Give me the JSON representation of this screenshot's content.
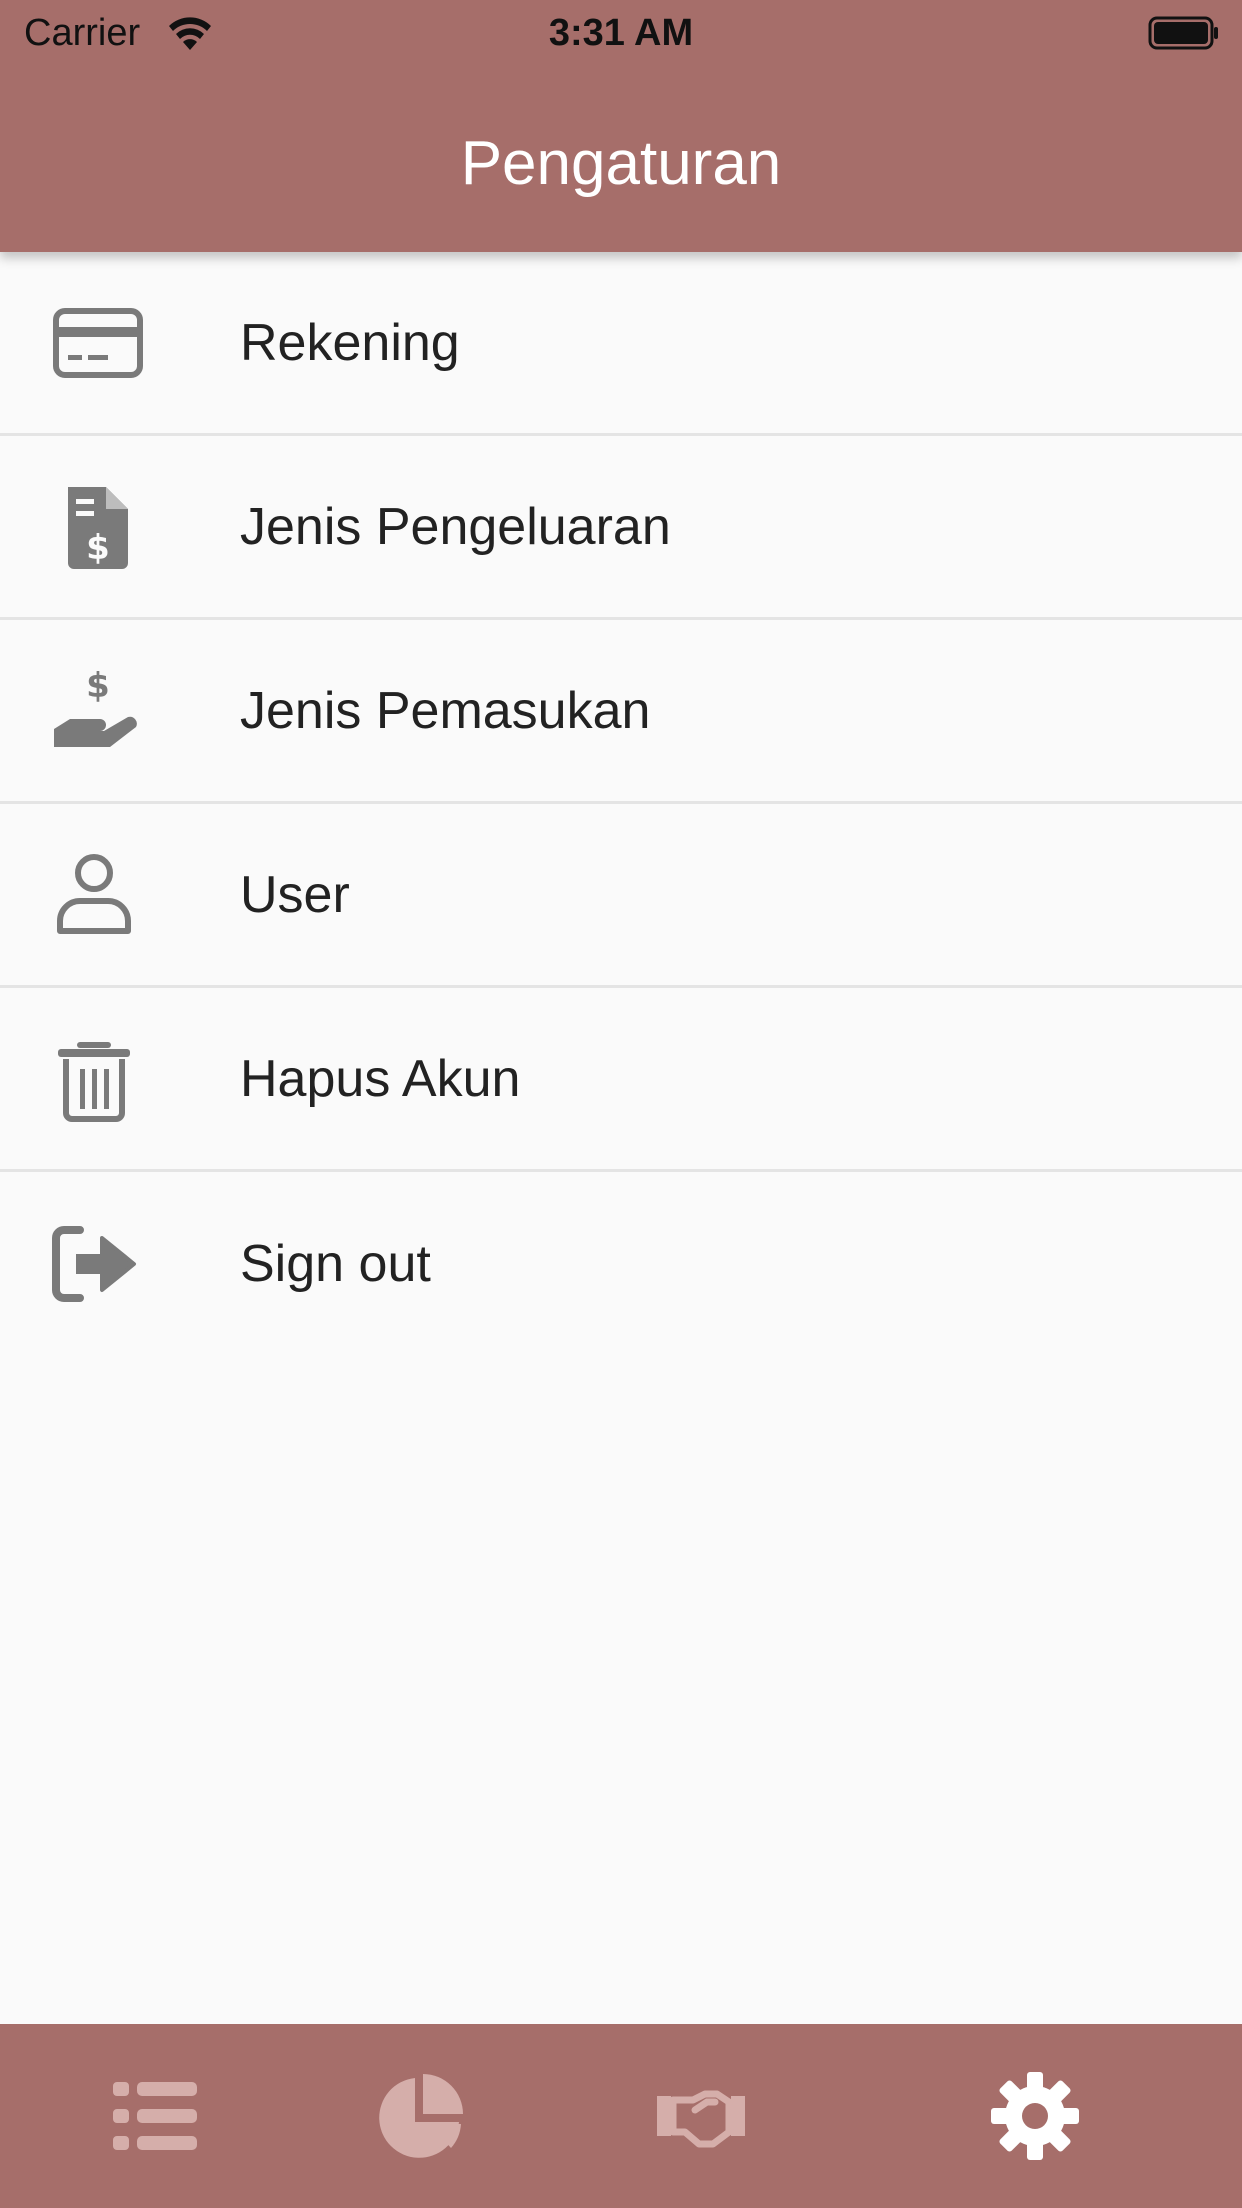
{
  "status_bar": {
    "carrier": "Carrier",
    "time": "3:31 AM"
  },
  "header": {
    "title": "Pengaturan"
  },
  "menu": {
    "items": [
      {
        "label": "Rekening",
        "icon": "credit-card-icon"
      },
      {
        "label": "Jenis Pengeluaran",
        "icon": "invoice-dollar-icon"
      },
      {
        "label": "Jenis Pemasukan",
        "icon": "hand-dollar-icon"
      },
      {
        "label": "User",
        "icon": "user-icon"
      },
      {
        "label": "Hapus Akun",
        "icon": "trash-icon"
      },
      {
        "label": "Sign out",
        "icon": "sign-out-icon"
      }
    ]
  },
  "tabbar": {
    "tabs": [
      {
        "icon": "list-icon",
        "active": false
      },
      {
        "icon": "pie-chart-icon",
        "active": false
      },
      {
        "icon": "handshake-icon",
        "active": false
      },
      {
        "icon": "gear-icon",
        "active": true
      }
    ]
  },
  "colors": {
    "primary": "#a66e6a",
    "background": "#fafafa",
    "icon_gray": "#7a7a7a",
    "tab_inactive": "#d5aeaa",
    "tab_active": "#ffffff"
  }
}
